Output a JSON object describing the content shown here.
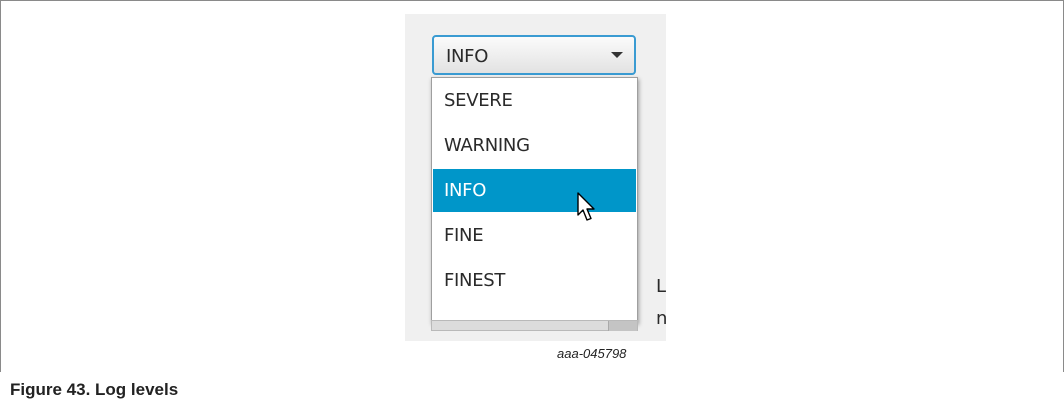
{
  "combo": {
    "value": "INFO"
  },
  "options": [
    "SEVERE",
    "WARNING",
    "INFO",
    "FINE",
    "FINEST"
  ],
  "selected_option": "INFO",
  "truncated_text": {
    "line1": "L",
    "line2": "n"
  },
  "image_tag": "aaa-045798",
  "figure": {
    "title": "Figure 43.  Log levels"
  },
  "colors": {
    "selected_bg": "#0096c9",
    "focus_border": "#3a9bd2"
  }
}
